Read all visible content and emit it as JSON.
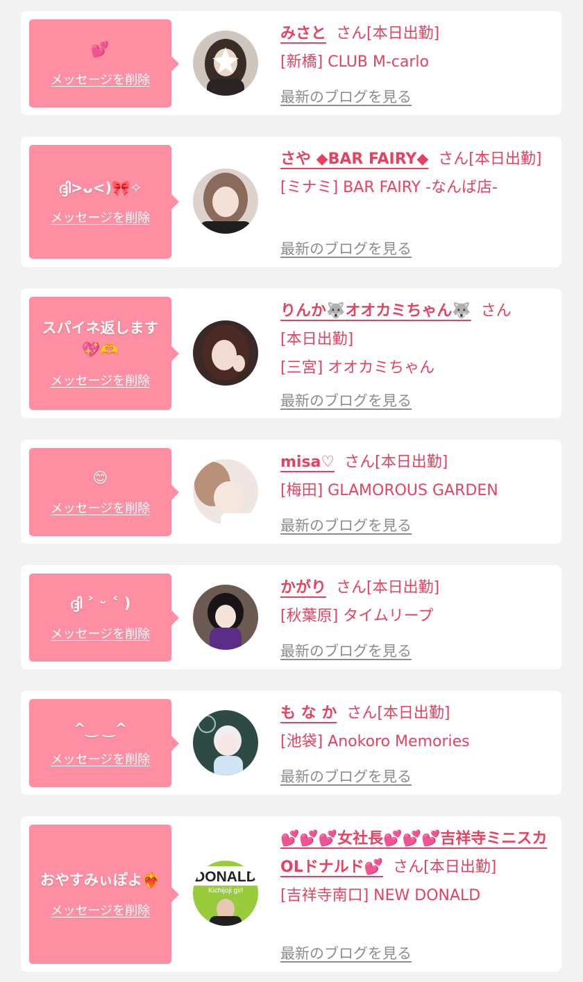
{
  "theme": {
    "pink": "#fe8fa3",
    "accent": "#e6425f",
    "muted": "#8c8c8c"
  },
  "delete_label": "メッセージを削除",
  "blog_label": "最新のブログを見る",
  "san_label": "さん",
  "status_label": "[本日出勤]",
  "items": [
    {
      "message": "💕",
      "name": "みさと",
      "area": "[新橋]",
      "shop": "CLUB M-carlo"
    },
    {
      "message": "ദ്ദി>ᴗ<)🎀✧",
      "name": "さや ◆BAR FAIRY◆",
      "area": "[ミナミ]",
      "shop": "BAR FAIRY -なんば店-"
    },
    {
      "message": "スパイネ返します💖🫶",
      "name": "りんか🐺オオカミちゃん🐺",
      "area": "[三宮]",
      "shop": "オオカミちゃん"
    },
    {
      "message": "😊",
      "name": "misa♡",
      "area": "[梅田]",
      "shop": "GLAMOROUS GARDEN"
    },
    {
      "message": "ദ്ദി ˃ ᵕ ˂ )",
      "name": "かがり",
      "area": "[秋葉原]",
      "shop": "タイムリープ"
    },
    {
      "message": "^‿ ‿^",
      "name": "も な か",
      "area": "[池袋]",
      "shop": "Anokoro Memories"
    },
    {
      "message": "おやすみぃぽよ❤️‍🔥",
      "name": "💕💕💕女社長💕💕💕吉祥寺ミニスカOLドナルド💕",
      "area": "[吉祥寺南口]",
      "shop": "NEW DONALD",
      "avatar_text": "DONALD",
      "avatar_subtext": "Kichijoji girl"
    }
  ]
}
